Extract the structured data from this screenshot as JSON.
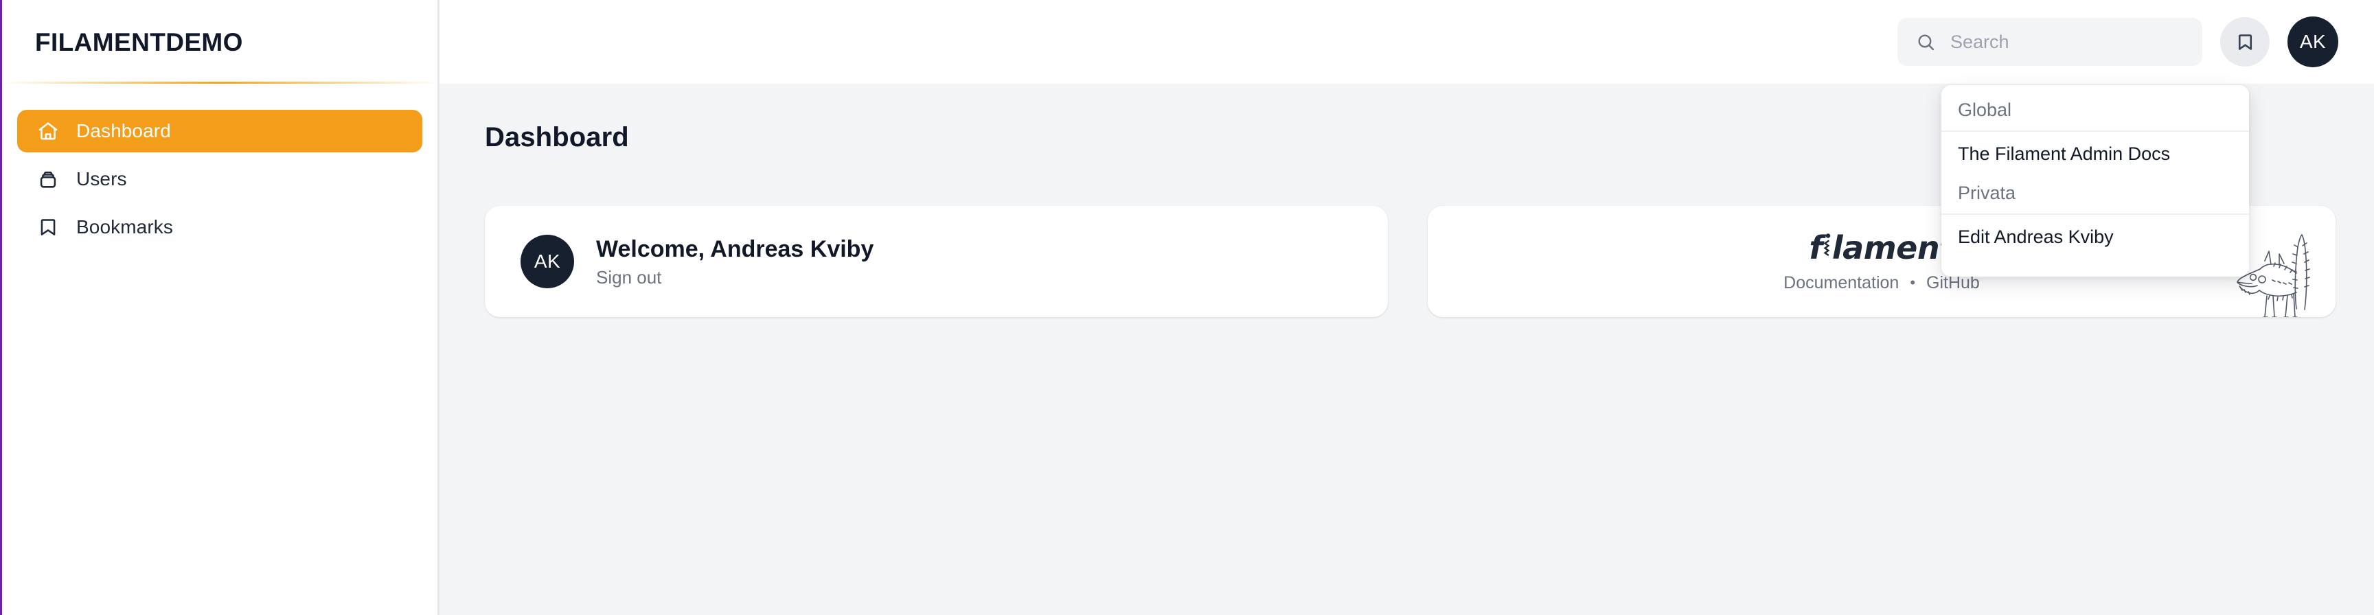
{
  "brand": {
    "name": "FILAMENTDEMO"
  },
  "sidebar": {
    "items": [
      {
        "label": "Dashboard",
        "icon": "home-icon",
        "active": true
      },
      {
        "label": "Users",
        "icon": "users-icon",
        "active": false
      },
      {
        "label": "Bookmarks",
        "icon": "bookmark-icon",
        "active": false
      }
    ]
  },
  "topbar": {
    "search": {
      "placeholder": "Search",
      "value": "",
      "icon": "search-icon"
    },
    "bookmarks_button": {
      "icon": "bookmark-icon",
      "label": "Bookmarks"
    },
    "avatar": {
      "initials": "AK",
      "label": "Andreas Kviby"
    }
  },
  "dropdown": {
    "visible": true,
    "groups": [
      {
        "label": "Global",
        "items": [
          {
            "label": "The Filament Admin Docs"
          }
        ]
      },
      {
        "label": "Privata",
        "items": [
          {
            "label": "Edit Andreas Kviby"
          }
        ]
      }
    ]
  },
  "page": {
    "title": "Dashboard"
  },
  "widgets": {
    "welcome": {
      "avatar_initials": "AK",
      "title": "Welcome, Andreas Kviby",
      "signout_label": "Sign out"
    },
    "filament": {
      "logo_pre": "f",
      "logo_i": "i",
      "logo_post": "lament",
      "logo_text": "filament",
      "links": [
        {
          "label": "Documentation"
        },
        {
          "label": "GitHub"
        }
      ],
      "separator": "•",
      "mascot": "wolf-illustration"
    }
  },
  "colors": {
    "accent": "#F49D1B",
    "dark": "#17202e",
    "page_bg": "#f3f4f6",
    "card_bg": "#ffffff",
    "muted_text": "#6b7280",
    "brand_text": "#111827",
    "edge_accent": "#6b21a8"
  }
}
